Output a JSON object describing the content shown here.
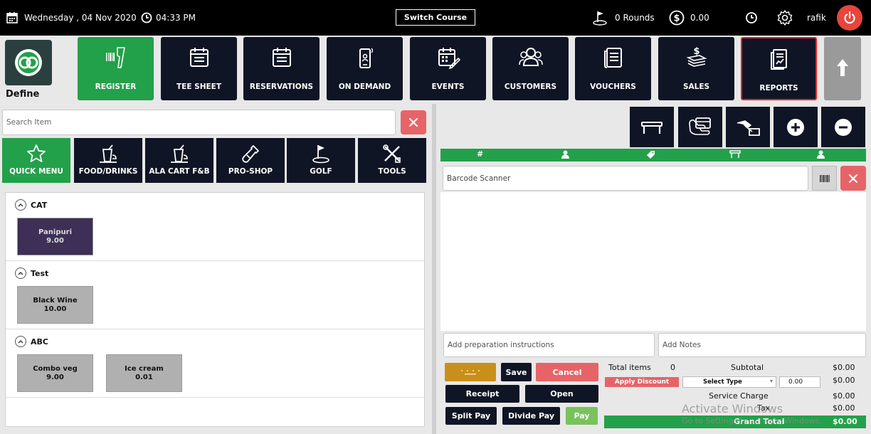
{
  "topbar": {
    "date": "Wednesday , 04 Nov 2020",
    "time": "04:33 PM",
    "switch_course": "Switch Course",
    "rounds": "0 Rounds",
    "balance": "0.00",
    "user": "rafik"
  },
  "brand": {
    "label": "Define"
  },
  "nav": {
    "register": "REGISTER",
    "tee_sheet": "TEE SHEET",
    "reservations": "RESERVATIONS",
    "on_demand": "ON DEMAND",
    "events": "EVENTS",
    "customers": "CUSTOMERS",
    "vouchers": "VOUCHERS",
    "sales": "SALES",
    "reports": "REPORTS"
  },
  "search": {
    "placeholder": "Search Item"
  },
  "categories": {
    "quick_menu": "QUICK MENU",
    "food_drinks": "FOOD/DRINKS",
    "ala_cart": "ALA CART F&B",
    "pro_shop": "PRO-SHOP",
    "golf": "GOLF",
    "tools": "TOOLS"
  },
  "menu": [
    {
      "name": "CAT",
      "items": [
        {
          "name": "Panipuri",
          "price": "9.00"
        }
      ]
    },
    {
      "name": "Test",
      "items": [
        {
          "name": "Black Wine",
          "price": "10.00"
        }
      ]
    },
    {
      "name": "ABC",
      "items": [
        {
          "name": "Combo veg",
          "price": "9.00"
        },
        {
          "name": "Ice cream",
          "price": "0.01"
        }
      ]
    }
  ],
  "cart": {
    "header_cols": [
      "#",
      "user-icon",
      "tag-icon",
      "table-icon",
      "user-icon"
    ],
    "hash": "#",
    "barcode_placeholder": "Barcode Scanner",
    "prep_placeholder": "Add preparation instructions",
    "notes_placeholder": "Add Notes"
  },
  "actions": {
    "save": "Save",
    "cancel": "Cancel",
    "receipt": "Receipt",
    "open": "Open",
    "split_pay": "Split Pay",
    "divide_pay": "Divide Pay",
    "pay": "Pay"
  },
  "totals": {
    "total_items_label": "Total items",
    "total_items_value": "0",
    "subtotal_label": "Subtotal",
    "subtotal_value": "$0.00",
    "apply_discount": "Apply Discount",
    "select_type": "Select Type",
    "discount_input": "0.00",
    "discount_value": "$0.00",
    "service_charge_label": "Service Charge",
    "service_charge_value": "$0.00",
    "tax_label": "Tax",
    "tax_value": "$0.00",
    "grand_total_label": "Grand Total",
    "grand_total_value": "$0.00"
  },
  "watermark": {
    "line1": "Activate Windows",
    "line2": "Go to Settings to activate Windows."
  },
  "colors": {
    "green": "#23a04a",
    "navy": "#0f1525",
    "red": "#e66467",
    "purple_tile": "#3d2f55"
  }
}
